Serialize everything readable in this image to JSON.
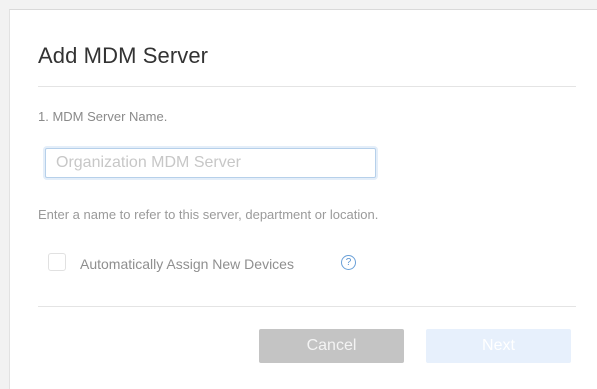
{
  "dialog": {
    "title": "Add MDM Server",
    "step_label": "1. MDM Server Name.",
    "name_input": {
      "value": "",
      "placeholder": "Organization MDM Server"
    },
    "helper_text": "Enter a name to refer to this server, department or location.",
    "auto_assign": {
      "label": "Automatically Assign New Devices",
      "checked": false,
      "help_icon": "question-circle-icon",
      "help_glyph": "?"
    },
    "buttons": {
      "cancel_label": "Cancel",
      "next_label": "Next"
    }
  },
  "colors": {
    "accent": "#5b94d1",
    "cancel_bg": "#c4c4c4",
    "next_bg_disabled": "#e7f0fc"
  }
}
